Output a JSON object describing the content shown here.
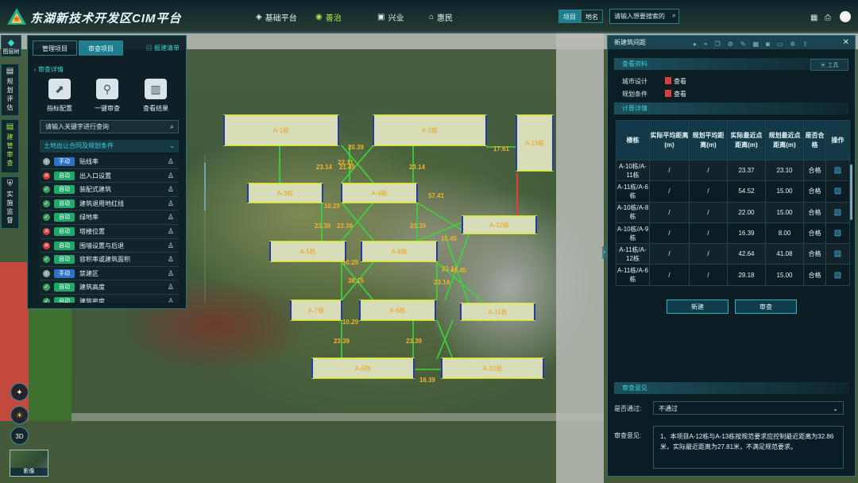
{
  "header": {
    "title": "东湖新技术开发区CIM平台",
    "nav": [
      {
        "label": "基础平台",
        "icon": "cube-icon"
      },
      {
        "label": "善治",
        "icon": "shield-leaf-icon"
      },
      {
        "label": "兴业",
        "icon": "briefcase-icon"
      },
      {
        "label": "惠民",
        "icon": "home-icon"
      }
    ],
    "active_nav": "善治",
    "search_scope": [
      "项目",
      "地名"
    ],
    "search_placeholder": "请输入想要搜索的"
  },
  "left_strip": {
    "layers_label": "图层树",
    "items": [
      "规划评估",
      "建管审查",
      "实施监督"
    ]
  },
  "left_panel": {
    "tabs": [
      "管理项目",
      "审查项目"
    ],
    "active_tab": "审查项目",
    "list_link": "报建清单",
    "back_link": "审查详情",
    "tools": [
      "指标配置",
      "一键审查",
      "查看结果"
    ],
    "search_placeholder": "请输入关键字进行查询",
    "section_title": "土地出让合同及规划条件",
    "rows": [
      {
        "status": "info",
        "mode": "手动",
        "name": "贴线率"
      },
      {
        "status": "err",
        "mode": "自动",
        "name": "出入口设置"
      },
      {
        "status": "ok",
        "mode": "自动",
        "name": "装配式建筑"
      },
      {
        "status": "ok",
        "mode": "自动",
        "name": "建筑退用地红线"
      },
      {
        "status": "ok",
        "mode": "自动",
        "name": "绿地率"
      },
      {
        "status": "err",
        "mode": "自动",
        "name": "塔楼位置"
      },
      {
        "status": "err",
        "mode": "自动",
        "name": "围墙设置与后退"
      },
      {
        "status": "ok",
        "mode": "自动",
        "name": "容积率或建筑面积"
      },
      {
        "status": "info",
        "mode": "手动",
        "name": "禁建区"
      },
      {
        "status": "ok",
        "mode": "自动",
        "name": "建筑高度"
      },
      {
        "status": "ok",
        "mode": "自动",
        "name": "建筑密度"
      }
    ]
  },
  "map": {
    "buildings": [
      "A-1栋",
      "A-2栋",
      "A-13栋",
      "A-3栋",
      "A-4栋",
      "A-12栋",
      "A-5栋",
      "A-6栋",
      "A-7栋",
      "A-8栋",
      "A-11栋",
      "A-9栋",
      "A-10栋"
    ],
    "distance_labels": [
      "20.39",
      "22.11",
      "23.14",
      "23.14",
      "17.61",
      "21.49",
      "57.41",
      "10.29",
      "23.39",
      "23.39",
      "23.39",
      "15.45",
      "10.29",
      "38.15",
      "23.14",
      "23.14",
      "42.45",
      "10.29",
      "23.39",
      "23.39",
      "16.39"
    ],
    "controls": [
      "compass-icon",
      "sun-icon",
      "3D"
    ],
    "minimap_label": "影像"
  },
  "right_panel": {
    "title": "新建筑间距",
    "tools_button": "工具",
    "materials_title": "查看资料",
    "materials": [
      {
        "label": "城市设计",
        "link": "查看"
      },
      {
        "label": "规划条件",
        "link": "查看"
      }
    ],
    "calc_title": "计算详情",
    "columns": [
      "楼栋",
      "实际平均距离(m)",
      "规划平均距离(m)",
      "实际最近点距离(m)",
      "规划最近点距离(m)",
      "是否合格",
      "操作"
    ],
    "rows": [
      {
        "pair": "A-10栋/A-11栋",
        "act_avg": "/",
        "plan_avg": "/",
        "act_min": "23.37",
        "plan_min": "23.10",
        "pass": "合格"
      },
      {
        "pair": "A-11栋/A-6栋",
        "act_avg": "/",
        "plan_avg": "/",
        "act_min": "54.52",
        "plan_min": "15.00",
        "pass": "合格"
      },
      {
        "pair": "A-10栋/A-8栋",
        "act_avg": "/",
        "plan_avg": "/",
        "act_min": "22.00",
        "plan_min": "15.00",
        "pass": "合格"
      },
      {
        "pair": "A-10栋/A-9栋",
        "act_avg": "/",
        "plan_avg": "/",
        "act_min": "16.39",
        "plan_min": "8.00",
        "pass": "合格"
      },
      {
        "pair": "A-11栋/A-12栋",
        "act_avg": "/",
        "plan_avg": "/",
        "act_min": "42.64",
        "plan_min": "41.08",
        "pass": "合格"
      },
      {
        "pair": "A-11栋/A-6栋",
        "act_avg": "/",
        "plan_avg": "/",
        "act_min": "29.18",
        "plan_min": "15.00",
        "pass": "合格"
      }
    ],
    "buttons": [
      "新建",
      "审查"
    ],
    "review_title": "审查意见",
    "pass_label": "是否通过:",
    "pass_value": "不通过",
    "opinion_label": "审查意见:",
    "opinion_text": "1、本项目A-12栋与A-13栋按规范要求应控制最近距离为32.86米，实际最近距离为27.81米，不满足规范要求。"
  },
  "colors": {
    "accent": "#1f7f8f",
    "pass": "#a6e84e",
    "building_outline": "#e8f03c",
    "distance_line": "#3cd63c",
    "violation_line": "#e83c3c"
  }
}
